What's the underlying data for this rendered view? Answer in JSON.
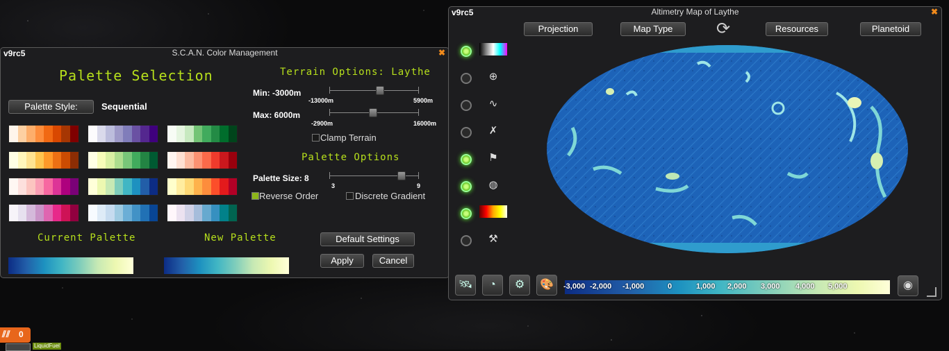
{
  "color_window": {
    "version": "v9rc5",
    "title": "S.C.A.N. Color Management",
    "palette_selection": "Palette Selection",
    "palette_style_button": "Palette Style:",
    "palette_style_value": "Sequential",
    "terrain_options": "Terrain Options: Laythe",
    "min_label": "Min: -3000m",
    "min_low": "-13000m",
    "min_high": "5900m",
    "min_fraction": 0.55,
    "max_label": "Max: 6000m",
    "max_low": "-2900m",
    "max_high": "16000m",
    "max_fraction": 0.48,
    "clamp_terrain": "Clamp Terrain",
    "palette_options": "Palette Options",
    "palette_size_label": "Palette Size: 8",
    "size_low": "3",
    "size_high": "9",
    "size_fraction": 0.83,
    "reverse_order": "Reverse Order",
    "discrete_gradient": "Discrete Gradient",
    "current_palette": "Current Palette",
    "new_palette": "New Palette",
    "default_settings": "Default Settings",
    "apply": "Apply",
    "cancel": "Cancel",
    "palettes": [
      [
        "#fff5eb",
        "#fdd0a2",
        "#fdae6b",
        "#fd8d3c",
        "#f16913",
        "#d94801",
        "#a63603",
        "#7f0000"
      ],
      [
        "#fcfbfd",
        "#dadaeb",
        "#bcbddc",
        "#9e9ac8",
        "#807dba",
        "#6a51a3",
        "#54278f",
        "#3f007d"
      ],
      [
        "#f7fcf5",
        "#e5f5e0",
        "#c7e9c0",
        "#74c476",
        "#41ab5d",
        "#238b45",
        "#006d2c",
        "#00441b"
      ],
      [
        "#ffffe5",
        "#fff7bc",
        "#fee391",
        "#fec44f",
        "#fe9929",
        "#ec7014",
        "#cc4c02",
        "#8c2d04"
      ],
      [
        "#ffffe5",
        "#f7fcb9",
        "#d9f0a3",
        "#addd8e",
        "#78c679",
        "#41ab5d",
        "#238443",
        "#005a32"
      ],
      [
        "#fff5f0",
        "#fee0d2",
        "#fcbba1",
        "#fc9272",
        "#fb6a4a",
        "#ef3b2c",
        "#cb181d",
        "#99000d"
      ],
      [
        "#fff7f3",
        "#fde0dd",
        "#fcc5c0",
        "#fa9fb5",
        "#f768a1",
        "#dd3497",
        "#ae017e",
        "#7a0177"
      ],
      [
        "#ffffd9",
        "#edf8b1",
        "#c7e9b4",
        "#7fcdbb",
        "#41b6c4",
        "#1d91c0",
        "#225ea8",
        "#0c2c84"
      ],
      [
        "#ffffcc",
        "#ffeda0",
        "#fed976",
        "#feb24c",
        "#fd8d3c",
        "#fc4e2a",
        "#e31a1c",
        "#b10026"
      ],
      [
        "#f7f4f9",
        "#e7e1ef",
        "#d4b9da",
        "#c994c7",
        "#df65b0",
        "#e7298a",
        "#ce1256",
        "#91003f"
      ],
      [
        "#f7fbff",
        "#deebf7",
        "#c6dbef",
        "#9ecae1",
        "#6baed6",
        "#4292c6",
        "#2171b5",
        "#084594"
      ],
      [
        "#fff7fb",
        "#ece2f0",
        "#d0d1e6",
        "#a6bddb",
        "#67a9cf",
        "#3690c0",
        "#02818a",
        "#016450"
      ]
    ]
  },
  "map_window": {
    "version": "v9rc5",
    "title": "Altimetry Map of Laythe",
    "projection": "Projection",
    "map_type": "Map Type",
    "resources": "Resources",
    "planetoid": "Planetoid",
    "toggles": [
      true,
      false,
      false,
      false,
      true,
      true,
      true,
      false
    ],
    "toggle_icons": [
      "color-legend-icon",
      "grid-icon",
      "orbit-icon",
      "waypoint-x-icon",
      "flag-icon",
      "anomaly-icon",
      "color-bar-icon",
      "mining-icon"
    ],
    "legend_ticks": [
      "-3,000",
      "-2,000",
      "-1,000",
      "0",
      "1,000",
      "2,000",
      "3,000",
      "4,000",
      "5,000"
    ],
    "bottom_icons": [
      "satellite-icon",
      "gauge-icon",
      "settings-gear-icon",
      "palette-icon"
    ]
  },
  "resource_bar": {
    "count": "0",
    "label": "LiquidFuel"
  }
}
